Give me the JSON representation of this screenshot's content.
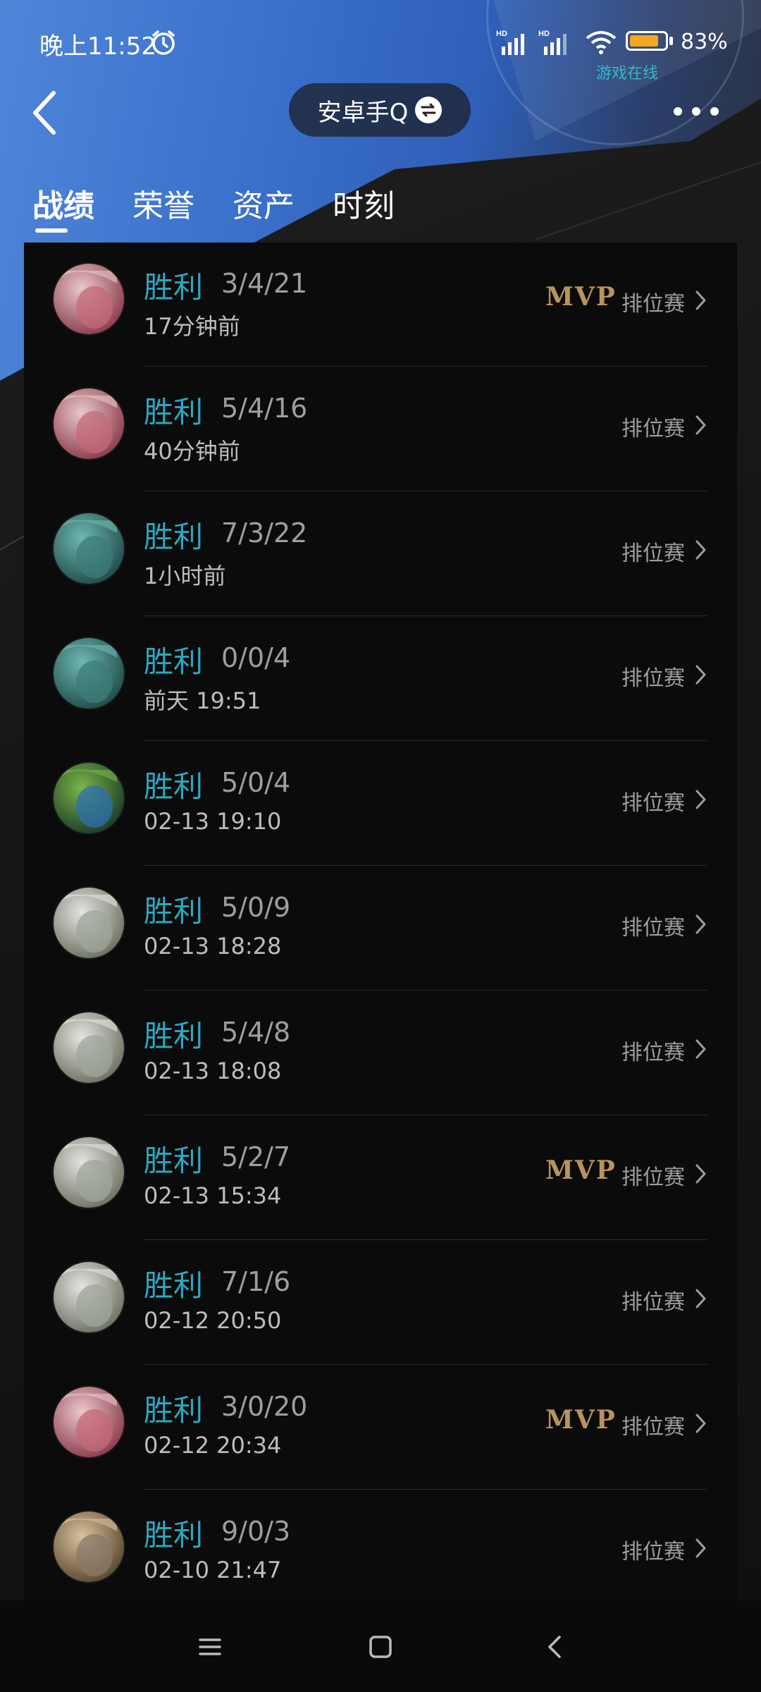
{
  "status_bar": {
    "time": "晚上11:52",
    "battery": "83%",
    "online_label": "游戏在线"
  },
  "header": {
    "title": "安卓手Q"
  },
  "tabs": [
    {
      "label": "战绩",
      "active": true
    },
    {
      "label": "荣誉",
      "active": false
    },
    {
      "label": "资产",
      "active": false
    },
    {
      "label": "时刻",
      "active": false
    }
  ],
  "matches": [
    {
      "result": "胜利",
      "kda": "3/4/21",
      "time": "17分钟前",
      "mvp": "MVP",
      "mode": "排位赛",
      "hero": "pink-hair-hero"
    },
    {
      "result": "胜利",
      "kda": "5/4/16",
      "time": "40分钟前",
      "mvp": "",
      "mode": "排位赛",
      "hero": "pink-hair-hero"
    },
    {
      "result": "胜利",
      "kda": "7/3/22",
      "time": "1小时前",
      "mvp": "",
      "mode": "排位赛",
      "hero": "teal-skin-hero"
    },
    {
      "result": "胜利",
      "kda": "0/0/4",
      "time": "前天 19:51",
      "mvp": "",
      "mode": "排位赛",
      "hero": "teal-skin-hero"
    },
    {
      "result": "胜利",
      "kda": "5/0/4",
      "time": "02-13 19:10",
      "mvp": "",
      "mode": "排位赛",
      "hero": "green-creature-hero"
    },
    {
      "result": "胜利",
      "kda": "5/0/9",
      "time": "02-13 18:28",
      "mvp": "",
      "mode": "排位赛",
      "hero": "white-hair-hero"
    },
    {
      "result": "胜利",
      "kda": "5/4/8",
      "time": "02-13 18:08",
      "mvp": "",
      "mode": "排位赛",
      "hero": "white-hair-hero"
    },
    {
      "result": "胜利",
      "kda": "5/2/7",
      "time": "02-13 15:34",
      "mvp": "MVP",
      "mode": "排位赛",
      "hero": "white-hair-hero"
    },
    {
      "result": "胜利",
      "kda": "7/1/6",
      "time": "02-12 20:50",
      "mvp": "",
      "mode": "排位赛",
      "hero": "white-hair-hero"
    },
    {
      "result": "胜利",
      "kda": "3/0/20",
      "time": "02-12 20:34",
      "mvp": "MVP",
      "mode": "排位赛",
      "hero": "pink-hair-hero"
    },
    {
      "result": "胜利",
      "kda": "9/0/3",
      "time": "02-10 21:47",
      "mvp": "",
      "mode": "排位赛",
      "hero": "golden-armor-hero"
    }
  ],
  "avatar_colors": {
    "pink-hair-hero": [
      "#e8c8c8",
      "#8a3a4a",
      "#c46a7a"
    ],
    "teal-skin-hero": [
      "#6fb8b0",
      "#1f4a4a",
      "#3d7d78"
    ],
    "green-creature-hero": [
      "#7ab648",
      "#1d3a2a",
      "#2d6fb0"
    ],
    "white-hair-hero": [
      "#e4e4e0",
      "#6a7060",
      "#a0a69a"
    ],
    "golden-armor-hero": [
      "#d8c29a",
      "#5a4630",
      "#8a7a6a"
    ]
  },
  "nav": [
    "menu-icon",
    "home-icon",
    "back-icon"
  ]
}
